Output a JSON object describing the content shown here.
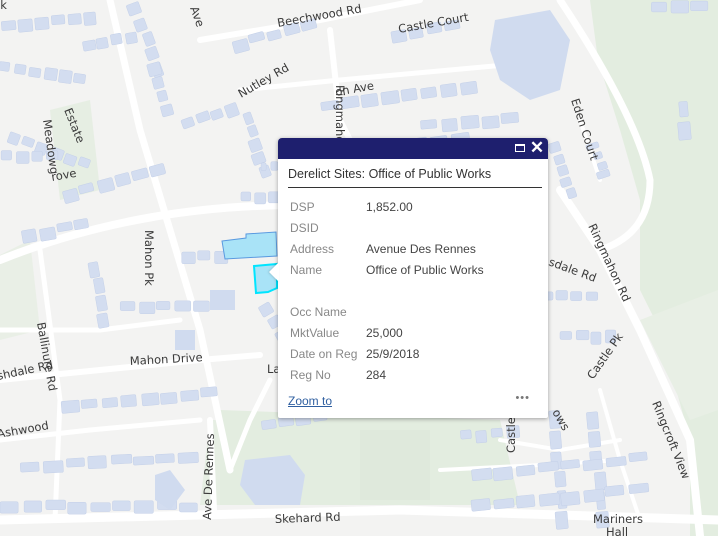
{
  "map": {
    "street_labels": [
      {
        "id": "ave-top",
        "text": "Ave"
      },
      {
        "id": "beechwood-rd",
        "text": "Beechwood Rd"
      },
      {
        "id": "castle-court",
        "text": "Castle Court"
      },
      {
        "id": "nutley-rd",
        "text": "Nutley Rd"
      },
      {
        "id": "mahon-ave",
        "text": "on Ave"
      },
      {
        "id": "ringmahon-vert",
        "text": "Ringmahon"
      },
      {
        "id": "eden-court",
        "text": "Eden Court"
      },
      {
        "id": "estate",
        "text": "Estate"
      },
      {
        "id": "meadow-grove-1",
        "text": "Meadowg"
      },
      {
        "id": "meadow-grove-2",
        "text": "rove"
      },
      {
        "id": "mahon-pk",
        "text": "Mahon Pk"
      },
      {
        "id": "ringmahon-rd",
        "text": "Ringmahon Rd"
      },
      {
        "id": "sdale-rd-right",
        "text": "sdale Rd"
      },
      {
        "id": "castle-pk",
        "text": "Castle Pk"
      },
      {
        "id": "ballinure-rd",
        "text": "Ballinure Rd"
      },
      {
        "id": "mahon-drive",
        "text": "Mahon Drive"
      },
      {
        "id": "ashdale-rd-left",
        "text": "shdale Rd"
      },
      {
        "id": "la",
        "text": "La"
      },
      {
        "id": "ashwood",
        "text": "Ashwood"
      },
      {
        "id": "ave-de-rennes",
        "text": "Ave De Rennes"
      },
      {
        "id": "skehard-rd",
        "text": "Skehard Rd"
      },
      {
        "id": "castle-meadows-1",
        "text": "Castle"
      },
      {
        "id": "castle-meadows-2",
        "text": "ows"
      },
      {
        "id": "ringcroft-view",
        "text": "Ringcroft View"
      },
      {
        "id": "mariners-hall-1",
        "text": "Mariners"
      },
      {
        "id": "mariners-hall-2",
        "text": "Hall"
      },
      {
        "id": "lk",
        "text": "lk"
      }
    ],
    "colors": {
      "background": "#f3f3f2",
      "road": "#ffffff",
      "building": "#d3ddf0",
      "green": "#e3ede0",
      "selected_parcel_fill": "#a9e3f7",
      "selected_parcel_outline": "#5a9ae0",
      "highlight_outline": "#00e5ff"
    }
  },
  "popup": {
    "title": "Derelict Sites: Office of Public Works",
    "maximize_icon": "maximize-icon",
    "close_icon": "close-icon",
    "close_glyph": "✕",
    "header_color": "#1e1f6e",
    "attributes": [
      {
        "key": "DSP",
        "value": "1,852.00"
      },
      {
        "key": "DSID",
        "value": ""
      },
      {
        "key": "Address",
        "value": "Avenue Des Rennes"
      },
      {
        "key": "Name",
        "value": "Office of Public Works"
      },
      {
        "key": "",
        "value": ""
      },
      {
        "key": "Occ Name",
        "value": ""
      },
      {
        "key": "MktValue",
        "value": "25,000"
      },
      {
        "key": "Date on Reg",
        "value": "25/9/2018"
      },
      {
        "key": "Reg No",
        "value": "284"
      }
    ],
    "zoom_to_label": "Zoom to",
    "more_label": "•••"
  }
}
